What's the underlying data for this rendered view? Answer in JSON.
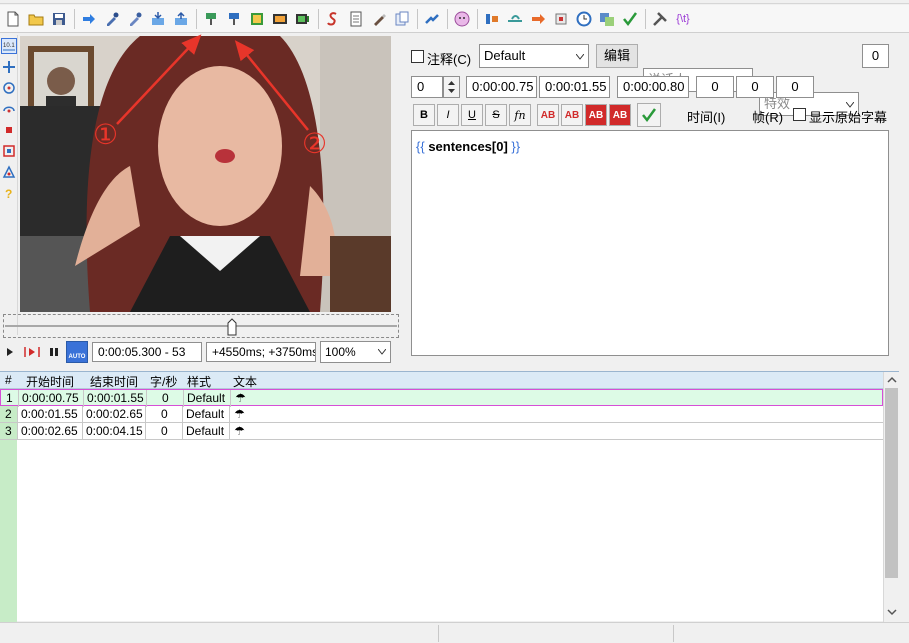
{
  "toolbar": {
    "icons": [
      "new-file-icon",
      "open-folder-icon",
      "save-icon",
      "arrow-right-icon",
      "dropper-icon",
      "dropper-alt-icon",
      "import-icon",
      "export-icon",
      "set-start-icon",
      "set-end-icon",
      "snap-icon",
      "film-icon",
      "film-alt-icon",
      "style-icon",
      "properties-icon",
      "brush-icon",
      "attach-icon",
      "translate-icon",
      "face-icon",
      "shift-icon",
      "jump-icon",
      "arrow-icon",
      "stop-icon",
      "clock-icon",
      "resample-icon",
      "spellcheck-icon",
      "tools-icon",
      "regex-icon"
    ],
    "regex_label": "{\\t}"
  },
  "side_toolbar": {
    "icons": [
      "standard-tool-icon",
      "move-tool-icon",
      "rotate-z-icon",
      "rotate-xy-icon",
      "scale-icon",
      "clip-rect-icon",
      "clip-vector-icon",
      "help-icon"
    ]
  },
  "seek": {
    "position_fraction": 0.58
  },
  "video_controls": {
    "time_display": "0:00:05.300 - 53",
    "offset_display": "+4550ms; +3750ms",
    "zoom": "100%",
    "auto_label": "AUTO"
  },
  "edit_panel": {
    "comment_label": "注释(C)",
    "style_value": "Default",
    "edit_button": "编辑",
    "actor_placeholder": "说话人",
    "effect_placeholder": "特效",
    "effect_number": "0",
    "layer_value": "0",
    "start_time": "0:00:00.75",
    "end_time": "0:00:01.55",
    "duration": "0:00:00.80",
    "margin_left": "0",
    "margin_right": "0",
    "margin_vertical": "0",
    "format_buttons": [
      "B",
      "I",
      "U",
      "S",
      "fn",
      "AB",
      "AB",
      "AB",
      "AB"
    ],
    "time_label": "时间(I)",
    "frame_label": "帧(R)",
    "show_original_label": "显示原始字幕",
    "editor_text_open": "{{",
    "editor_text_var": "sentences[0]",
    "editor_text_close": "}}"
  },
  "grid": {
    "headers": [
      "#",
      "开始时间",
      "结束时间",
      "字/秒",
      "样式",
      "文本"
    ],
    "rows": [
      {
        "num": "1",
        "start": "0:00:00.75",
        "end": "0:00:01.55",
        "cps": "0",
        "style": "Default",
        "text": "☂"
      },
      {
        "num": "2",
        "start": "0:00:01.55",
        "end": "0:00:02.65",
        "cps": "0",
        "style": "Default",
        "text": "☂"
      },
      {
        "num": "3",
        "start": "0:00:02.65",
        "end": "0:00:04.15",
        "cps": "0",
        "style": "Default",
        "text": "☂"
      }
    ]
  },
  "annotations": {
    "label_1": "①",
    "label_2": "②",
    "arrow_color": "#e8352a"
  },
  "colors": {
    "accent_red": "#e8352a",
    "grid_header": "#dbeaf6",
    "row_num_green": "#c7ecc7",
    "selected_row": "#ddfbe6"
  }
}
